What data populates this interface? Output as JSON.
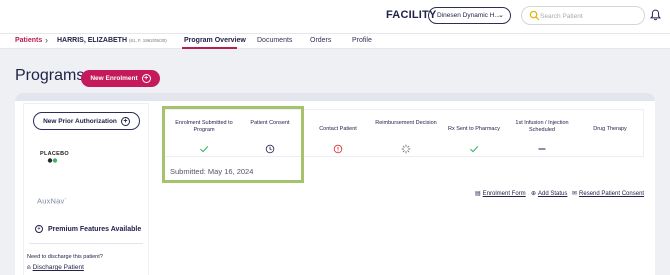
{
  "header": {
    "facility_label": "FACILITY",
    "facility_value": "Dinesen Dynamic H...",
    "search_placeholder": "Search Patient"
  },
  "breadcrumb": {
    "patients": "Patients",
    "patient_name": "HARRIS, ELIZABETH",
    "patient_meta": "(61, F, 1962/05/30)"
  },
  "tabs": [
    {
      "label": "Program Overview",
      "active": true
    },
    {
      "label": "Documents",
      "active": false
    },
    {
      "label": "Orders",
      "active": false
    },
    {
      "label": "Profile",
      "active": false
    }
  ],
  "page": {
    "title": "Programs",
    "new_enrolment_label": "New Enrolment"
  },
  "left_panel": {
    "new_prior_auth_label": "New Prior Authorization",
    "placebo_logo_text": "PLACEBO",
    "auxnav_logo_text": "AuxNav",
    "premium_label": "Premium Features Available",
    "discharge_question": "Need to discharge this patient?",
    "discharge_link": "Discharge Patient"
  },
  "steps": [
    {
      "label": "Enrolment Submitted to Program",
      "status": "complete",
      "icon": "check-icon"
    },
    {
      "label": "Patient Consent",
      "status": "pending",
      "icon": "clock-icon"
    },
    {
      "label": "Contact Patient",
      "status": "alert",
      "icon": "alert-icon"
    },
    {
      "label": "Reimbursement Decision",
      "status": "in-progress",
      "icon": "spinner-icon"
    },
    {
      "label": "Rx Sent to Pharmacy",
      "status": "complete",
      "icon": "check-icon"
    },
    {
      "label": "1st Infusion / Injection Scheduled",
      "status": "not-applicable",
      "icon": "dash-icon"
    },
    {
      "label": "Drug Therapy",
      "status": "none",
      "icon": ""
    }
  ],
  "submitted_text": "Submitted: May 16, 2024",
  "actions": [
    {
      "label": "Enrolment Form",
      "icon": "document-icon"
    },
    {
      "label": "Add Status",
      "icon": "plus-circle-icon"
    },
    {
      "label": "Resend Patient Consent",
      "icon": "mail-icon"
    }
  ],
  "colors": {
    "brand": "#c4195a",
    "navy": "#22224a",
    "success": "#3db36b",
    "alert": "#d9363e",
    "highlight": "#a6c26a"
  }
}
